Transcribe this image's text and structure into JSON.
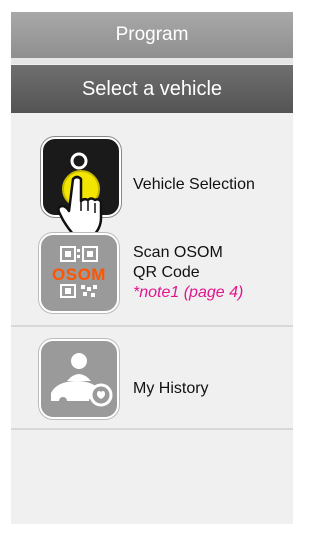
{
  "header": {
    "title": "Program",
    "subtitle": "Select a vehicle"
  },
  "menu": {
    "items": [
      {
        "label": "Vehicle Selection",
        "icon": "vehicle-select-icon"
      },
      {
        "label_line1": "Scan OSOM",
        "label_line2": "QR Code",
        "note": "*note1 (page 4)",
        "icon_text": "OSOM",
        "icon": "qr-code-icon"
      },
      {
        "label": "My History",
        "icon": "history-car-icon"
      }
    ]
  },
  "colors": {
    "header_light": "#999999",
    "header_dark": "#5f5f5f",
    "note": "#e0168f",
    "selected_icon_bg": "#1a1a1a",
    "accent_yellow": "#f2e600",
    "icon_gray": "#9a9a9a"
  }
}
